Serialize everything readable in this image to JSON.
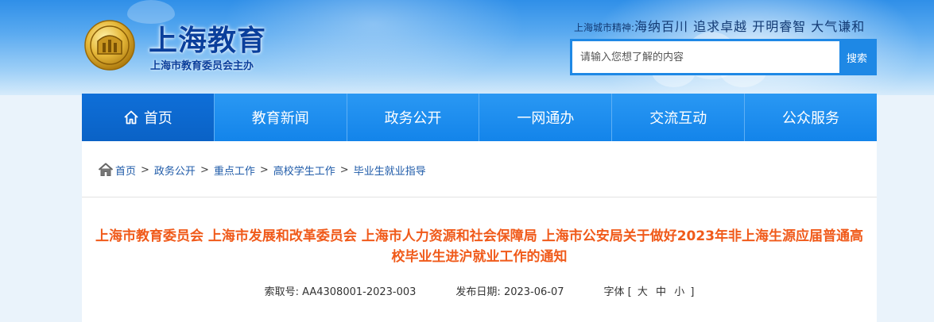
{
  "header": {
    "site_name": "上海教育",
    "site_sub": "上海市教育委员会主办",
    "motto_label": "上海城市精神:",
    "motto_text": "海纳百川 追求卓越 开明睿智 大气谦和",
    "search": {
      "placeholder": "请输入您想了解的内容",
      "button_label": "搜索"
    }
  },
  "nav": {
    "items": [
      {
        "label": "首页"
      },
      {
        "label": "教育新闻"
      },
      {
        "label": "政务公开"
      },
      {
        "label": "一网通办"
      },
      {
        "label": "交流互动"
      },
      {
        "label": "公众服务"
      }
    ]
  },
  "breadcrumb": {
    "items": [
      "首页",
      "政务公开",
      "重点工作",
      "高校学生工作",
      "毕业生就业指导"
    ],
    "separator": ">"
  },
  "article": {
    "title": "上海市教育委员会 上海市发展和改革委员会 上海市人力资源和社会保障局 上海市公安局关于做好2023年非上海生源应届普通高校毕业生进沪就业工作的通知",
    "index_label": "索取号:",
    "index_value": "AA4308001-2023-003",
    "date_label": "发布日期:",
    "date_value": "2023-06-07",
    "font_label": "字体 [",
    "font_large": "大",
    "font_medium": "中",
    "font_small": "小",
    "font_close": "]"
  },
  "colors": {
    "accent": "#1e88e5",
    "nav_bg": "#1f8ff0",
    "title": "#f05a1a",
    "link": "#1e5aa8"
  },
  "icons": {
    "logo": "shanghai-education-seal",
    "nav_home": "home-icon",
    "breadcrumb_home": "home-icon"
  }
}
